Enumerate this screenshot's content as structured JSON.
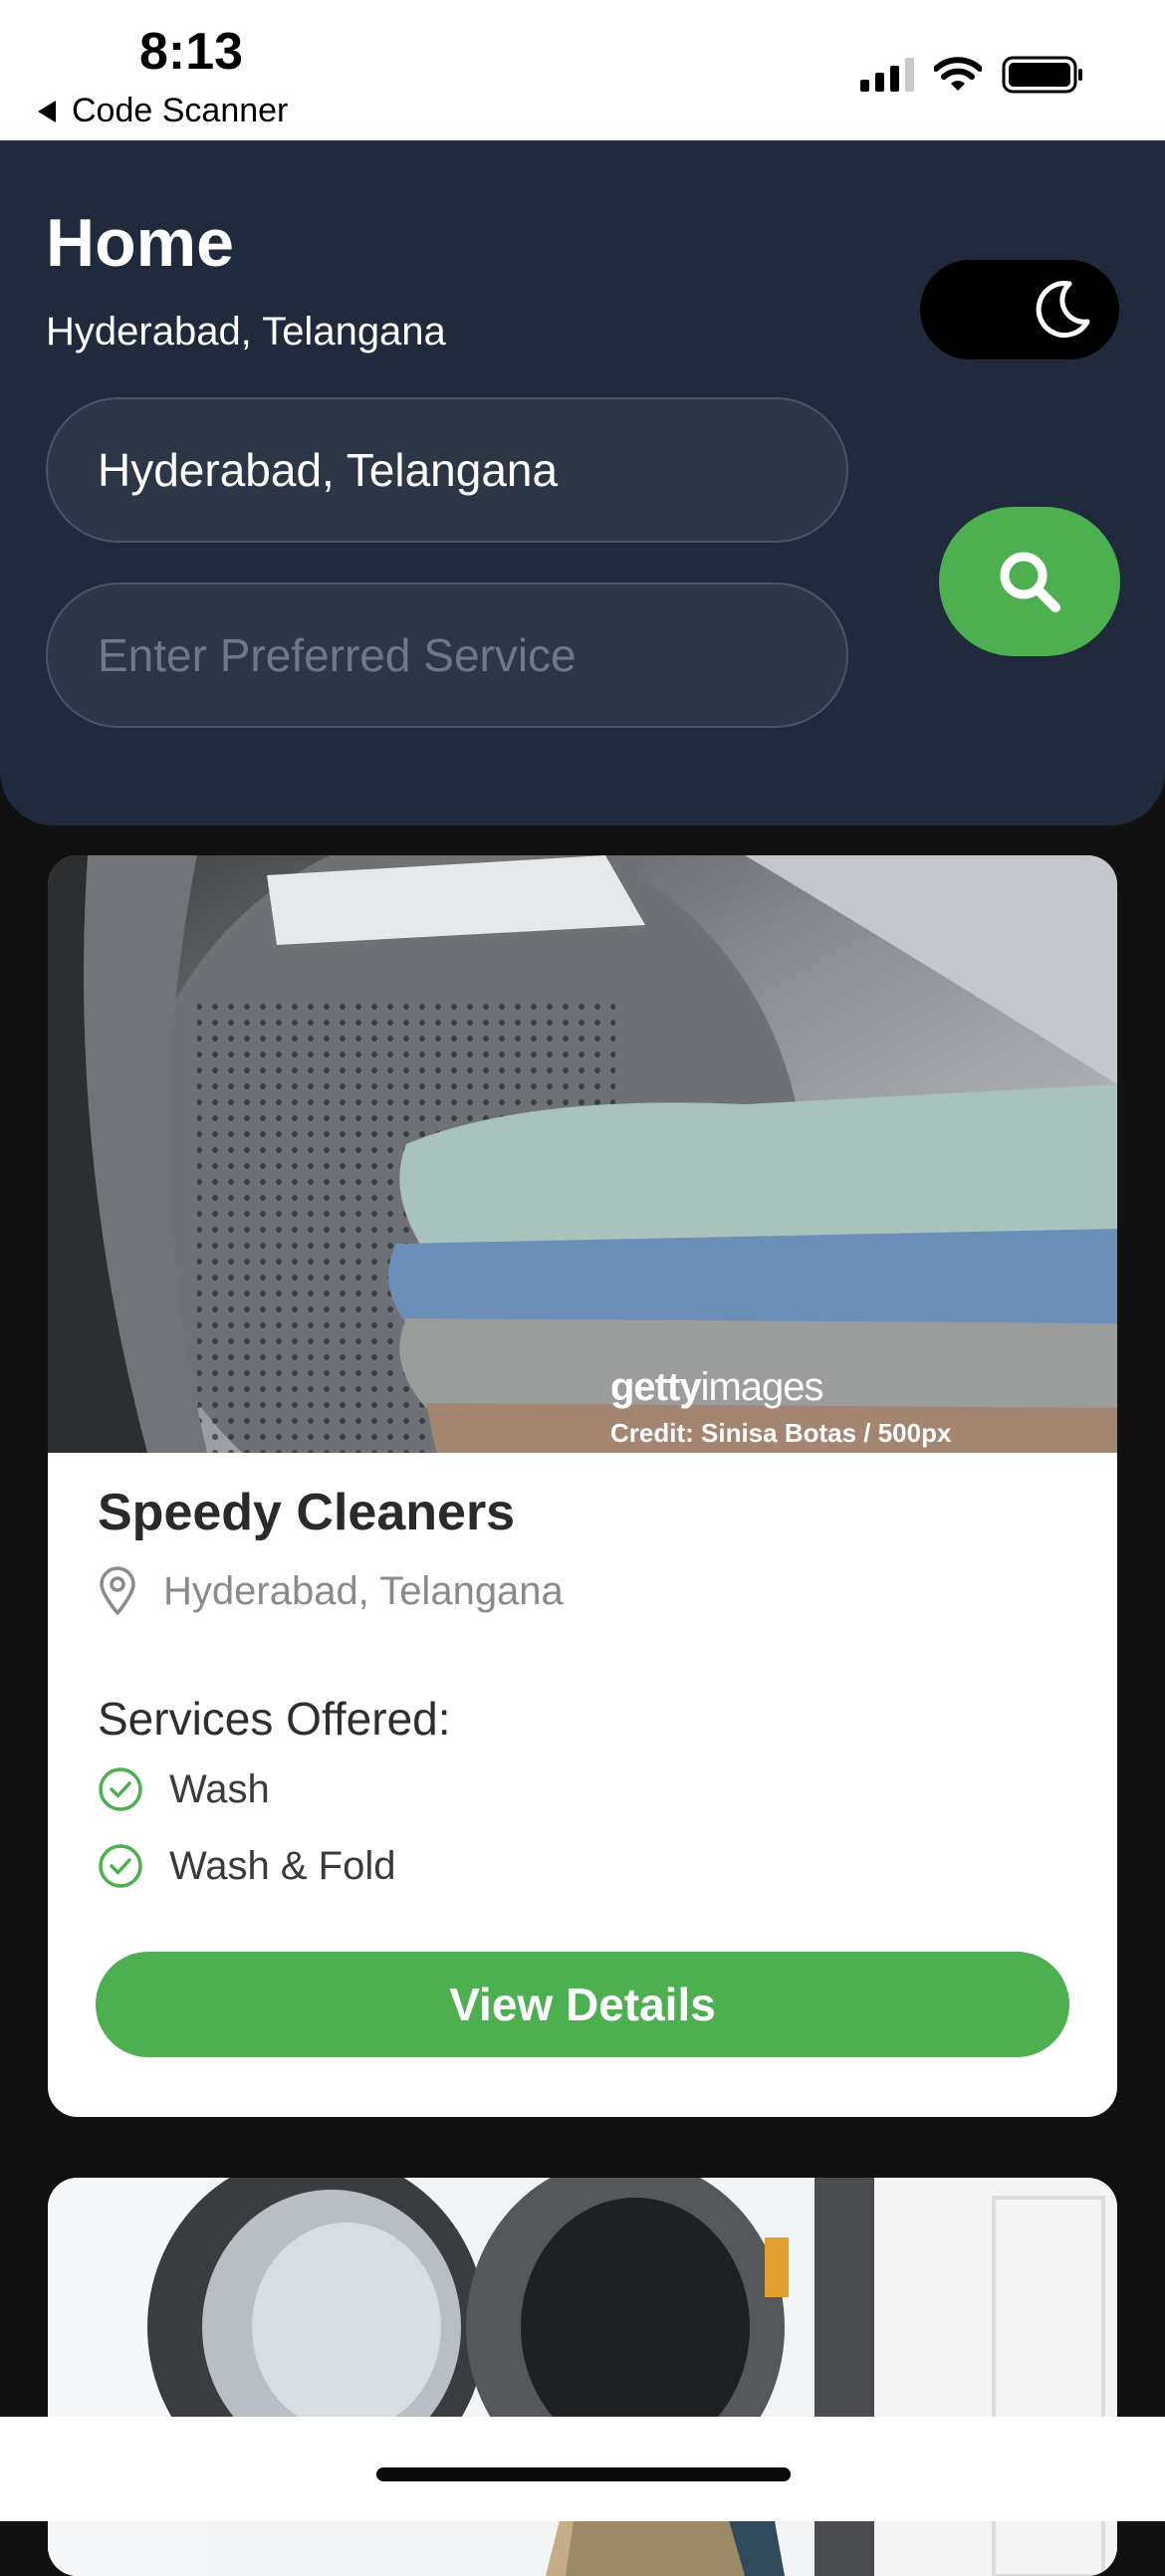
{
  "status_bar": {
    "time": "8:13",
    "back_app": "Code Scanner",
    "icons": [
      "signal-icon",
      "wifi-icon",
      "battery-icon"
    ]
  },
  "header": {
    "title": "Home",
    "subtitle": "Hyderabad, Telangana",
    "theme_toggle_icon": "moon-icon",
    "location_input_value": "Hyderabad, Telangana",
    "service_input_placeholder": "Enter Preferred Service",
    "search_icon": "search-icon"
  },
  "cards": [
    {
      "image_credit_brand_bold": "getty",
      "image_credit_brand_light": "images",
      "image_credit_line": "Credit: Sinisa Botas / 500px",
      "name": "Speedy Cleaners",
      "location": "Hyderabad, Telangana",
      "services_heading": "Services Offered:",
      "services": [
        "Wash",
        "Wash & Fold"
      ],
      "button_label": "View Details"
    }
  ],
  "colors": {
    "header_bg": "#202a3c",
    "accent_green": "#4caf50",
    "page_bg": "#111112"
  }
}
